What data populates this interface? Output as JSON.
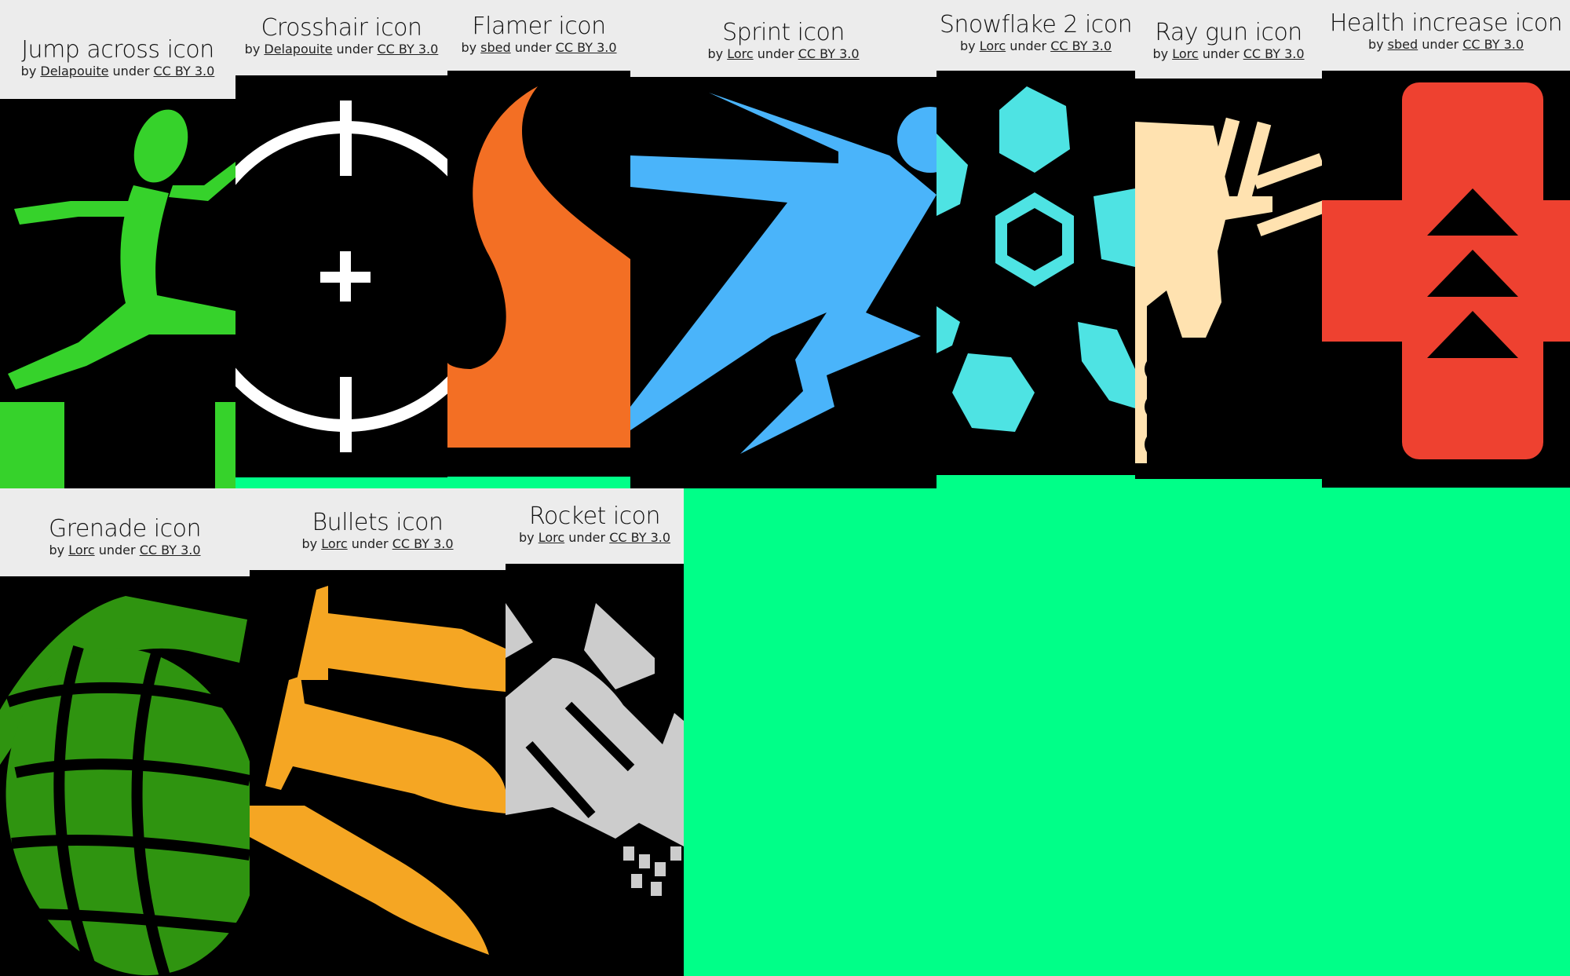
{
  "page": {
    "background": "#00ff88"
  },
  "common": {
    "by": "by",
    "under": "under"
  },
  "cards": [
    {
      "title": "Jump across icon",
      "author": "Delapouite",
      "license": "CC BY 3.0",
      "icon": "jump-across-icon",
      "color": "#36d22b"
    },
    {
      "title": "Crosshair icon",
      "author": "Delapouite",
      "license": "CC BY 3.0",
      "icon": "crosshair-icon",
      "color": "#ffffff"
    },
    {
      "title": "Flamer icon",
      "author": "sbed",
      "license": "CC BY 3.0",
      "icon": "flamer-icon",
      "color": "#f36f24"
    },
    {
      "title": "Sprint icon",
      "author": "Lorc",
      "license": "CC BY 3.0",
      "icon": "sprint-icon",
      "color": "#4ab4fa"
    },
    {
      "title": "Snowflake 2 icon",
      "author": "Lorc",
      "license": "CC BY 3.0",
      "icon": "snowflake-icon",
      "color": "#4ee3e3"
    },
    {
      "title": "Ray gun icon",
      "author": "Lorc",
      "license": "CC BY 3.0",
      "icon": "ray-gun-icon",
      "color": "#ffe2b0"
    },
    {
      "title": "Health increase icon",
      "author": "sbed",
      "license": "CC BY 3.0",
      "icon": "health-increase-icon",
      "color": "#ee4130"
    },
    {
      "title": "Grenade icon",
      "author": "Lorc",
      "license": "CC BY 3.0",
      "icon": "grenade-icon",
      "color": "#2f9410"
    },
    {
      "title": "Bullets icon",
      "author": "Lorc",
      "license": "CC BY 3.0",
      "icon": "bullets-icon",
      "color": "#f5a623"
    },
    {
      "title": "Rocket icon",
      "author": "Lorc",
      "license": "CC BY 3.0",
      "icon": "rocket-icon",
      "color": "#cccccc"
    }
  ]
}
